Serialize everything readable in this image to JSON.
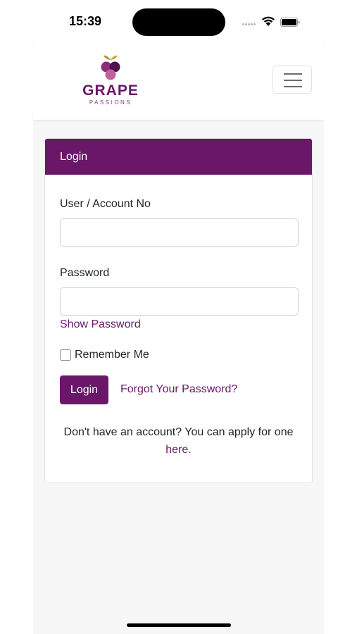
{
  "status_bar": {
    "time": "15:39",
    "icons": [
      "cellular-dots-icon",
      "wifi-icon",
      "battery-icon"
    ]
  },
  "brand": {
    "name": "GRAPE",
    "tagline": "PASSIONS",
    "colors": {
      "primary": "#6a176a",
      "grape_light": "#a8548e",
      "leaf": "#b69a3a"
    }
  },
  "navbar": {
    "menu_icon": "hamburger-menu-icon"
  },
  "login_card": {
    "title": "Login",
    "user_label": "User / Account No",
    "user_value": "",
    "password_label": "Password",
    "password_value": "",
    "show_password": "Show Password",
    "remember_me": "Remember Me",
    "remember_checked": false,
    "login_button": "Login",
    "forgot_link": "Forgot Your Password?",
    "apply_text": "Don't have an account? You can apply for one",
    "apply_link": "here."
  }
}
